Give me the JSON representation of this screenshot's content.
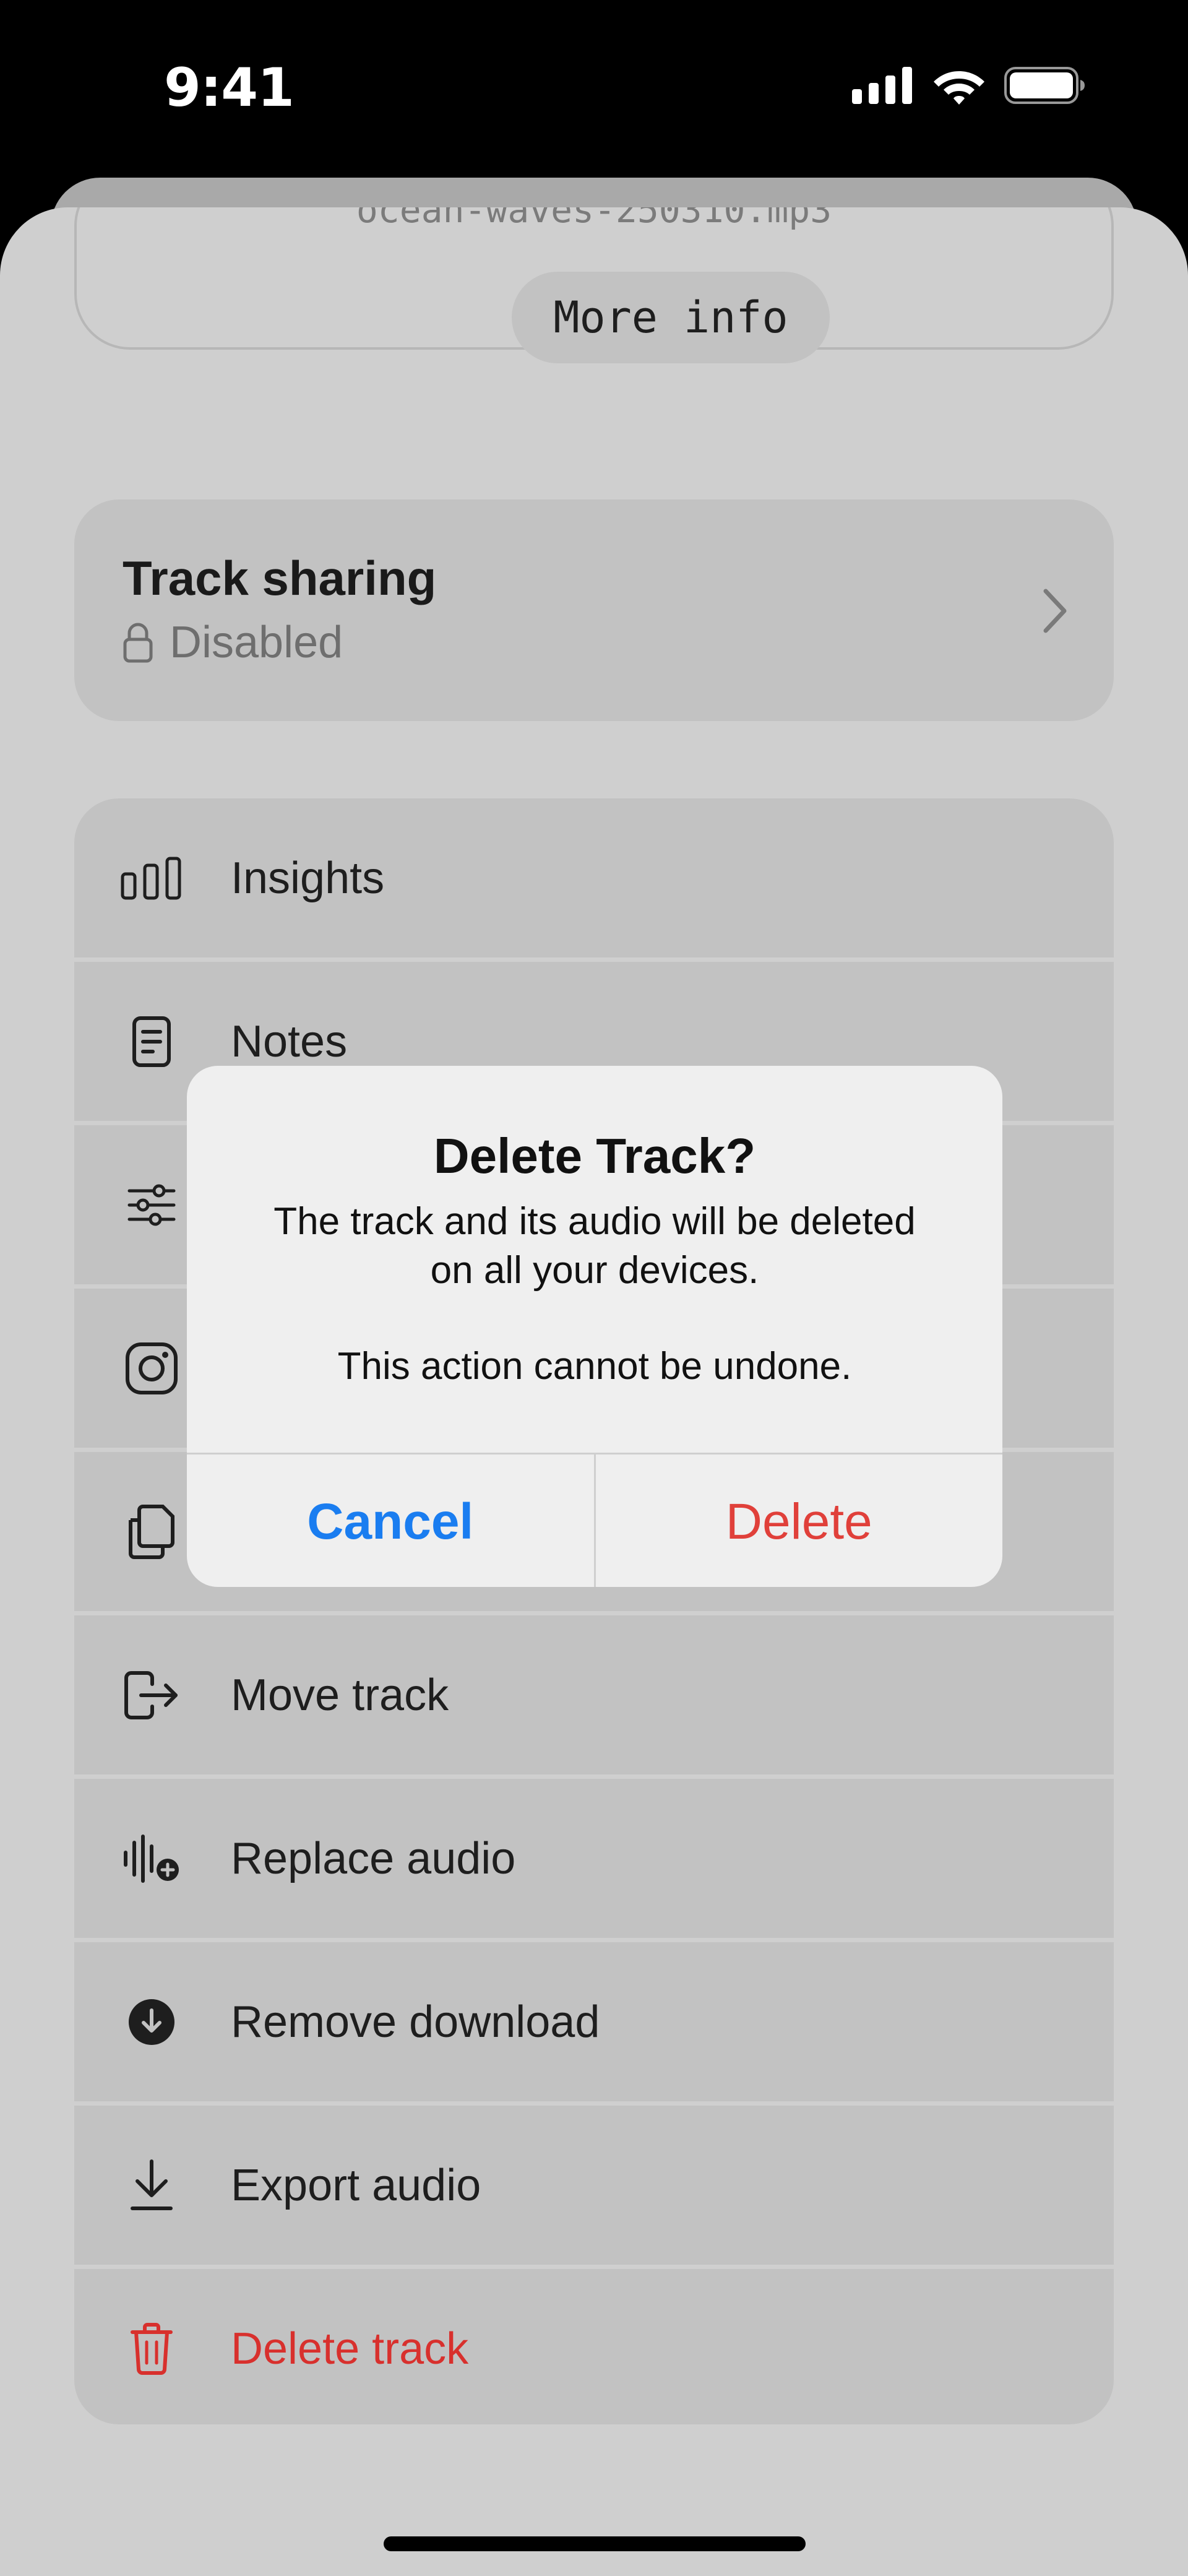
{
  "status_bar": {
    "time": "9:41"
  },
  "track": {
    "filename": "ocean-waves-250310.mp3",
    "more_info_label": "More info"
  },
  "sharing": {
    "title": "Track sharing",
    "status": "Disabled",
    "icon": "lock-icon"
  },
  "menu": {
    "items": [
      {
        "label": "Insights",
        "icon": "bar-chart-icon"
      },
      {
        "label": "Notes",
        "icon": "notes-icon"
      },
      {
        "label": "",
        "icon": "sliders-icon"
      },
      {
        "label": "",
        "icon": "instagram-icon"
      },
      {
        "label": "",
        "icon": "copy-icon"
      },
      {
        "label": "Move track",
        "icon": "move-out-icon"
      },
      {
        "label": "Replace audio",
        "icon": "waveform-add-icon"
      },
      {
        "label": "Remove download",
        "icon": "download-circle-icon"
      },
      {
        "label": "Export audio",
        "icon": "export-icon"
      },
      {
        "label": "Delete track",
        "icon": "trash-icon"
      }
    ]
  },
  "dialog": {
    "title": "Delete Track?",
    "body_line1": "The track and its audio will be deleted",
    "body_line2": "on all your devices.",
    "note": "This action cannot be undone.",
    "cancel_label": "Cancel",
    "delete_label": "Delete"
  },
  "colors": {
    "accent_blue": "#1a7df0",
    "danger_red": "#d8302d",
    "sheet_bg": "#cfcfcf",
    "card_bg": "#c2c2c2",
    "dialog_bg": "#efefef"
  }
}
